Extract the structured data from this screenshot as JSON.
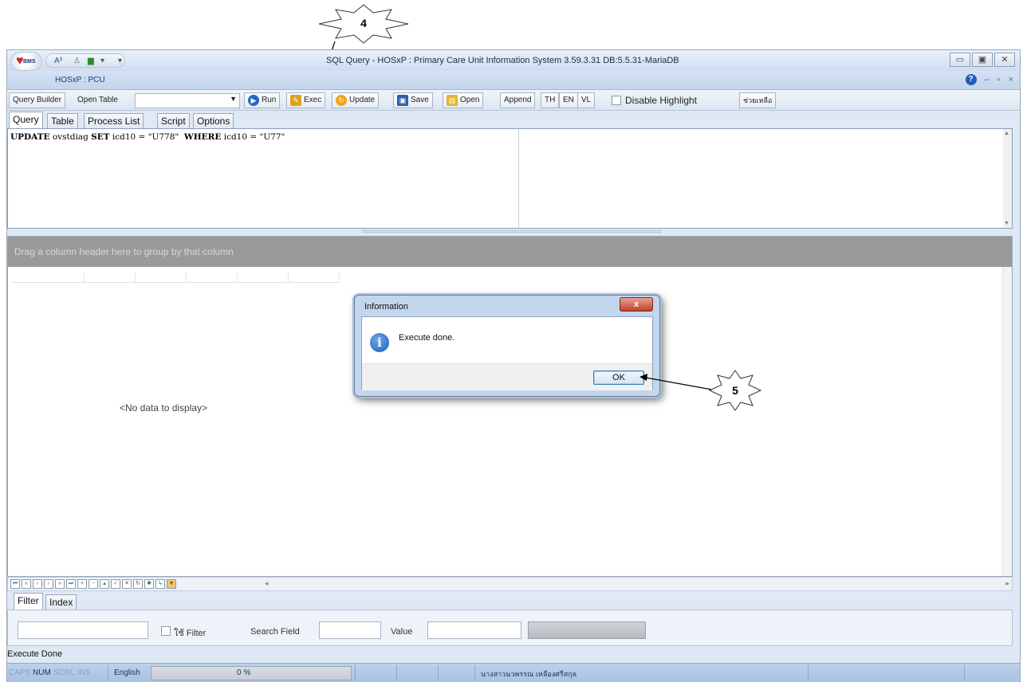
{
  "callouts": {
    "exec_marker": "4",
    "ok_marker": "5"
  },
  "window": {
    "title": "SQL Query -  HOSxP : Primary Care Unit Information System 3.59.3.31 DB:5.5.31-MariaDB",
    "app_subtitle": "HOSxP : PCU",
    "logo_text": "BMS"
  },
  "toolbar": {
    "query_builder": "Query Builder",
    "open_table": "Open Table",
    "run": "Run",
    "exec": "Exec",
    "update": "Update",
    "save": "Save",
    "open": "Open",
    "append": "Append",
    "th": "TH",
    "en": "EN",
    "vl": "VL",
    "disable_highlight": "Disable Highlight",
    "thai_button": "ช่วยเหลือ"
  },
  "tabs": [
    "Query",
    "Table",
    "Process List",
    "Script",
    "Options"
  ],
  "editor": {
    "kw_update": "UPDATE",
    "t1": " ovstdiag ",
    "kw_set": "SET",
    "t2": " icd10 = \"U778\"  ",
    "kw_where": "WHERE",
    "t3": " icd10 = \"U77\""
  },
  "grid": {
    "group_hint": "Drag a column header here to group by that column",
    "empty_text": "<No data to display>"
  },
  "filter_tabs": [
    "Filter",
    "Index"
  ],
  "filter": {
    "use_filter": "ใช้ Filter",
    "search_field": "Search Field",
    "value": "Value"
  },
  "status": {
    "exec_done": "Execute Done",
    "caps": "CAPS",
    "num": "NUM",
    "scrl": "SCRL",
    "ins": "INS",
    "language": "English",
    "progress": "0 %",
    "user": "นางสาวนวพรรณ  เหลืองศรีสกุล"
  },
  "dialog": {
    "title": "Information",
    "close": "x",
    "message": "Execute done.",
    "ok": "OK"
  },
  "colors": {
    "group_bar": "#9a9a9a",
    "dialog_frame": "#c3d6ee",
    "close_red": "#c4402b"
  }
}
